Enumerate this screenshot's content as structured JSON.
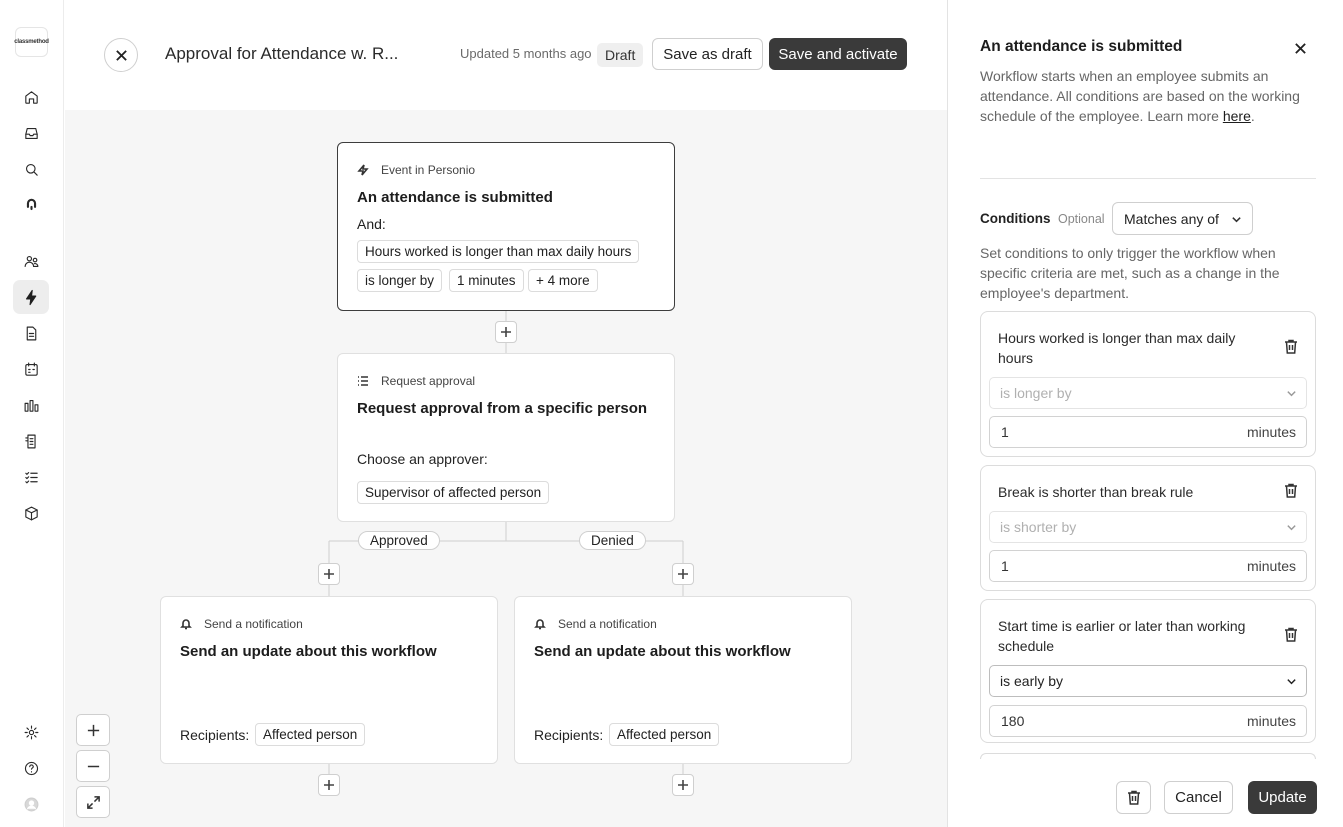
{
  "brand": {
    "logo_text": "classmethod"
  },
  "header": {
    "title": "Approval for Attendance w. R...",
    "updated": "Updated 5 months ago",
    "status": "Draft",
    "save_draft": "Save as draft",
    "save_activate": "Save and activate"
  },
  "workflow": {
    "trigger": {
      "type": "Event in Personio",
      "title": "An attendance is submitted",
      "and_label": "And:",
      "chips": [
        "Hours worked is longer than max daily hours",
        "is longer by",
        "1 minutes",
        "+ 4 more"
      ]
    },
    "approval": {
      "type": "Request approval",
      "title": "Request approval from a specific person",
      "approver_label": "Choose an approver:",
      "approver": "Supervisor of affected person"
    },
    "branches": {
      "approved": "Approved",
      "denied": "Denied"
    },
    "notifications": [
      {
        "type": "Send a notification",
        "title": "Send an update about this workflow",
        "recipients_label": "Recipients:",
        "recipient": "Affected person"
      },
      {
        "type": "Send a notification",
        "title": "Send an update about this workflow",
        "recipients_label": "Recipients:",
        "recipient": "Affected person"
      }
    ]
  },
  "panel": {
    "title": "An attendance is submitted",
    "description": "Workflow starts when an employee submits an attendance. All conditions are based on the working schedule of the employee. Learn more",
    "link_text": "here",
    "link_suffix": ".",
    "conditions_label": "Conditions",
    "optional_label": "Optional",
    "match_select": "Matches any of",
    "conditions_help": "Set conditions to only trigger the workflow when specific criteria are met, such as a change in the employee's department.",
    "conditions": [
      {
        "title": "Hours worked is longer than max daily hours",
        "operator": "is longer by",
        "value": "1",
        "unit": "minutes"
      },
      {
        "title": "Break is shorter than break rule",
        "operator": "is shorter by",
        "value": "1",
        "unit": "minutes"
      },
      {
        "title": "Start time is earlier or later than working schedule",
        "operator": "is early by",
        "value": "180",
        "unit": "minutes"
      }
    ],
    "cancel": "Cancel",
    "update": "Update"
  }
}
